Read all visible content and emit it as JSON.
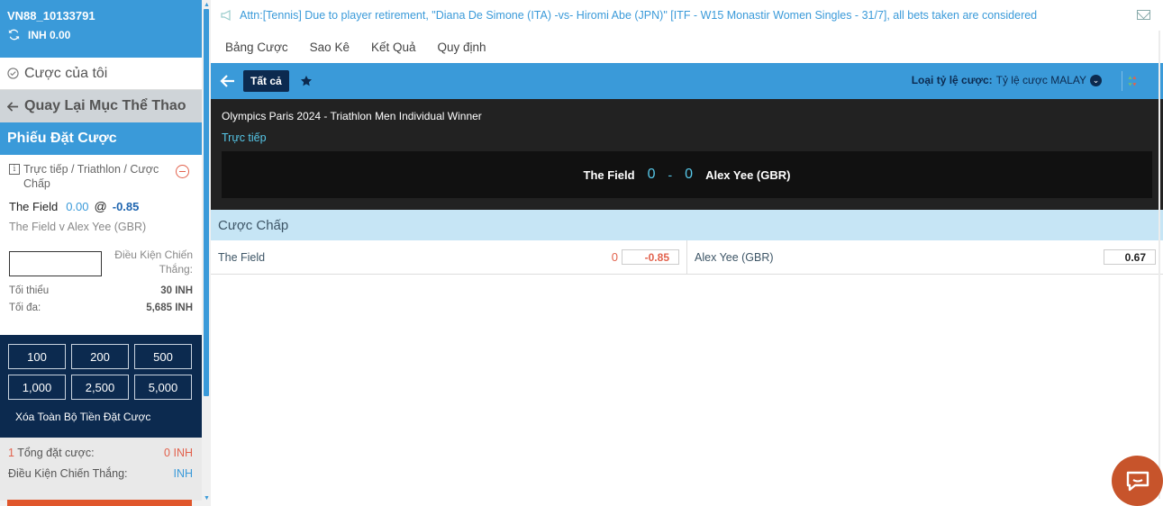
{
  "account": {
    "user_id": "VN88_10133791",
    "balance": "INH 0.00"
  },
  "sidebar": {
    "my_bets": "Cược của tôi",
    "back_to_sports": "Quay Lại Mục Thể Thao",
    "bet_slip_title": "Phiếu Đặt Cược",
    "bet": {
      "market_path": "Trực tiếp / Triathlon / Cược Chấp",
      "selection": "The Field",
      "handicap": "0.00",
      "at": "@",
      "odds": "-0.85",
      "match": "The Field v Alex Yee (GBR)"
    },
    "stake_placeholder": "",
    "win_condition_label": "Điều Kiện Chiến Thắng:",
    "min_label": "Tối thiểu",
    "min_value": "30 INH",
    "max_label": "Tối đa:",
    "max_value": "5,685 INH",
    "quick_stakes": [
      "100",
      "200",
      "500",
      "1,000",
      "2,500",
      "5,000"
    ],
    "clear_stakes": "Xóa Toàn Bộ Tiền Đặt Cược",
    "bet_count": "1",
    "total_stake_label": "Tổng đặt cược:",
    "total_stake_value": "0 INH",
    "win_cond_total_label": "Điều Kiện Chiến Thắng:",
    "win_cond_total_value": "INH"
  },
  "main": {
    "notice": "Attn:[Tennis] Due to player retirement, \"Diana De Simone (ITA) -vs- Hiromi Abe (JPN)\" [ITF - W15 Monastir Women Singles - 31/7], all bets taken are considered",
    "nav": [
      "Bảng Cược",
      "Sao Kê",
      "Kết Quả",
      "Quy định"
    ],
    "tab_all": "Tất cả",
    "odds_type_label": "Loại tỷ lệ cược:",
    "odds_type_value": "Tỷ lệ cược MALAY",
    "event_title": "Olympics Paris 2024 - Triathlon Men Individual Winner",
    "live_label": "Trực tiếp",
    "home": "The Field",
    "away": "Alex Yee (GBR)",
    "home_score": "0",
    "score_sep": "-",
    "away_score": "0",
    "market_title": "Cược Chấp",
    "row": {
      "home_name": "The Field",
      "home_hdp": "0",
      "home_price": "-0.85",
      "away_name": "Alex Yee (GBR)",
      "away_price": "0.67"
    }
  },
  "colors": {
    "primary": "#3a9ad9",
    "navy": "#0c2a4f",
    "accent": "#e2624d",
    "live": "#56c7e8"
  }
}
